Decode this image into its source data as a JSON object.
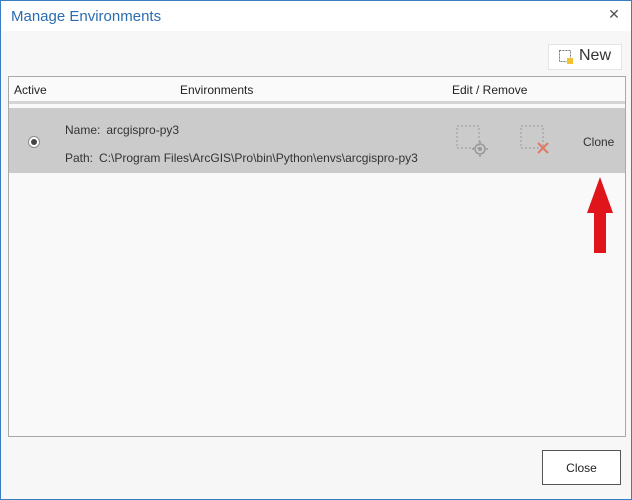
{
  "window": {
    "title": "Manage Environments"
  },
  "toolbar": {
    "new_label": "New"
  },
  "table": {
    "columns": {
      "active": "Active",
      "environments": "Environments",
      "edit_remove": "Edit / Remove"
    },
    "rows": [
      {
        "active": true,
        "name_key": "Name:",
        "name": "arcgispro-py3",
        "path_key": "Path:",
        "path": "C:\\Program Files\\ArcGIS\\Pro\\bin\\Python\\envs\\arcgispro-py3",
        "clone_label": "Clone"
      }
    ]
  },
  "footer": {
    "close_label": "Close"
  },
  "icons": {
    "close": "close-icon",
    "new": "new-environment-icon",
    "edit": "edit-settings-icon",
    "remove": "remove-icon",
    "annotation": "red-up-arrow"
  },
  "colors": {
    "title": "#2a6db0",
    "row_selected": "#cbcbcb",
    "remove_x": "#e07b67",
    "arrow": "#e0141b"
  }
}
